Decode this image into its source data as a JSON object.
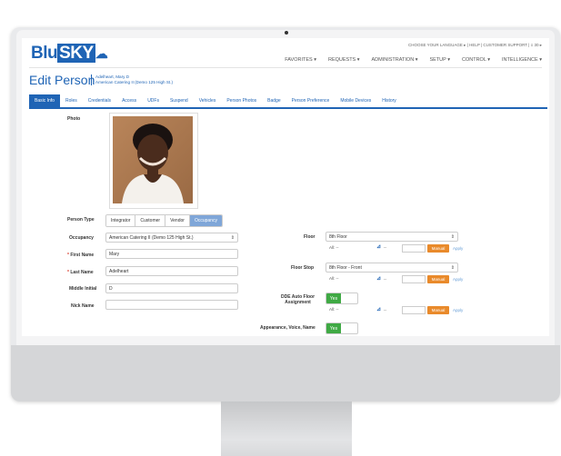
{
  "app": {
    "logo_part1": "Blu",
    "logo_part2": "SKY",
    "utility_links": "CHOOSE YOUR LANGUAGE ▸ | HELP | CUSTOMER SUPPORT | ≡ 30 ▸"
  },
  "topnav": [
    "FAVORITES ▾",
    "REQUESTS ▾",
    "ADMINISTRATION ▾",
    "SETUP ▾",
    "CONTROL ▾",
    "INTELLIGENCE ▾"
  ],
  "page": {
    "title": "Edit Person",
    "person_name": "Adelheart, Mary D",
    "person_company": "American Catering II (Demo 125 High St.)"
  },
  "tabs": [
    "Basic Info",
    "Roles",
    "Credentials",
    "Access",
    "UDFs",
    "Suspend",
    "Vehicles",
    "Person Photos",
    "Badge",
    "Person Preference",
    "Mobile Devices",
    "History"
  ],
  "active_tab": "Basic Info",
  "form": {
    "photo_label": "Photo",
    "person_type_label": "Person Type",
    "person_types": [
      "Integrator",
      "Customer",
      "Vendor",
      "Occupancy"
    ],
    "person_type_selected": "Occupancy",
    "occupancy_label": "Occupancy",
    "occupancy_value": "American Catering II (Demo 125 High St.)",
    "first_name_label": "First Name",
    "first_name_value": "Mary",
    "last_name_label": "Last Name",
    "last_name_value": "Adelheart",
    "middle_initial_label": "Middle Initial",
    "middle_initial_value": "D",
    "nick_name_label": "Nick Name",
    "nick_name_value": "",
    "required_marker": "*",
    "floor_label": "Floor",
    "floor_value": "8th Floor",
    "floor_stop_label": "Floor Stop",
    "floor_stop_value": "8th Floor - Front",
    "dde_label_line1": "DDE Auto Floor",
    "dde_label_line2": "Assignment",
    "appearance_label": "Appearance, Voice, Name",
    "all_text": "All: --",
    "dash": "--",
    "manual_label": "Manual",
    "apply_label": "Apply",
    "yes_label": "Yes",
    "icon_char": "⊿",
    "select_arrow": "⇕"
  }
}
